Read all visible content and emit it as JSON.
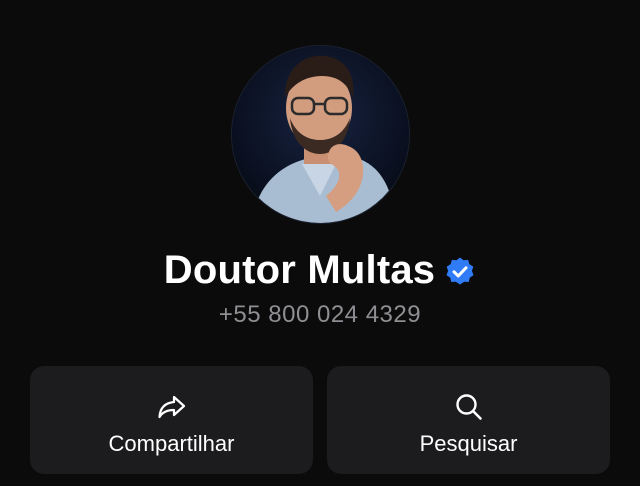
{
  "contact": {
    "name": "Doutor Multas",
    "phone": "+55 800 024 4329",
    "verified": true,
    "avatar_icon": "profile-photo"
  },
  "actions": [
    {
      "label": "Compartilhar",
      "icon": "share-arrow-icon"
    },
    {
      "label": "Pesquisar",
      "icon": "search-icon"
    }
  ],
  "colors": {
    "background": "#0b0b0b",
    "button_background": "#1c1c1e",
    "secondary_text": "#8e8e93",
    "verified_badge": "#2f7cf6"
  }
}
